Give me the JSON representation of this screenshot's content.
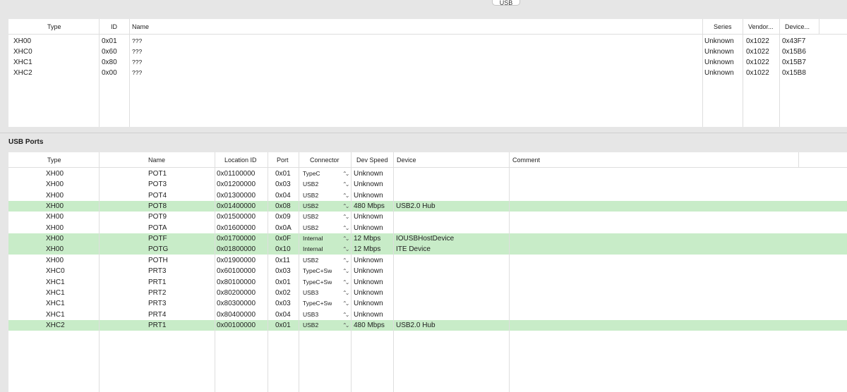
{
  "tab_label": "USB",
  "controllers": {
    "headers": {
      "type": "Type",
      "id": "ID",
      "name": "Name",
      "series": "Series",
      "vendor": "Vendor...",
      "device": "Device..."
    },
    "rows": [
      {
        "type": "XH00",
        "id": "0x01",
        "name": "???",
        "series": "Unknown",
        "vendor": "0x1022",
        "device": "0x43F7"
      },
      {
        "type": "XHC0",
        "id": "0x60",
        "name": "???",
        "series": "Unknown",
        "vendor": "0x1022",
        "device": "0x15B6"
      },
      {
        "type": "XHC1",
        "id": "0x80",
        "name": "???",
        "series": "Unknown",
        "vendor": "0x1022",
        "device": "0x15B7"
      },
      {
        "type": "XHC2",
        "id": "0x00",
        "name": "???",
        "series": "Unknown",
        "vendor": "0x1022",
        "device": "0x15B8"
      }
    ]
  },
  "ports_title": "USB Ports",
  "ports": {
    "headers": {
      "type": "Type",
      "name": "Name",
      "location": "Location ID",
      "port": "Port",
      "connector": "Connector",
      "speed": "Dev Speed",
      "device": "Device",
      "comment": "Comment"
    },
    "chevron": "⌃⌄",
    "rows": [
      {
        "type": "XH00",
        "name": "POT1",
        "location": "0x01100000",
        "port": "0x01",
        "connector": "TypeC",
        "speed": "Unknown",
        "device": "",
        "comment": "",
        "green": false
      },
      {
        "type": "XH00",
        "name": "POT3",
        "location": "0x01200000",
        "port": "0x03",
        "connector": "USB2",
        "speed": "Unknown",
        "device": "",
        "comment": "",
        "green": false
      },
      {
        "type": "XH00",
        "name": "POT4",
        "location": "0x01300000",
        "port": "0x04",
        "connector": "USB2",
        "speed": "Unknown",
        "device": "",
        "comment": "",
        "green": false
      },
      {
        "type": "XH00",
        "name": "POT8",
        "location": "0x01400000",
        "port": "0x08",
        "connector": "USB2",
        "speed": "480 Mbps",
        "device": "USB2.0 Hub",
        "comment": "",
        "green": true
      },
      {
        "type": "XH00",
        "name": "POT9",
        "location": "0x01500000",
        "port": "0x09",
        "connector": "USB2",
        "speed": "Unknown",
        "device": "",
        "comment": "",
        "green": false
      },
      {
        "type": "XH00",
        "name": "POTA",
        "location": "0x01600000",
        "port": "0x0A",
        "connector": "USB2",
        "speed": "Unknown",
        "device": "",
        "comment": "",
        "green": false
      },
      {
        "type": "XH00",
        "name": "POTF",
        "location": "0x01700000",
        "port": "0x0F",
        "connector": "Internal",
        "speed": "12 Mbps",
        "device": "IOUSBHostDevice",
        "comment": "",
        "green": true
      },
      {
        "type": "XH00",
        "name": "POTG",
        "location": "0x01800000",
        "port": "0x10",
        "connector": "Internal",
        "speed": "12 Mbps",
        "device": "ITE Device",
        "comment": "",
        "green": true
      },
      {
        "type": "XH00",
        "name": "POTH",
        "location": "0x01900000",
        "port": "0x11",
        "connector": "USB2",
        "speed": "Unknown",
        "device": "",
        "comment": "",
        "green": false
      },
      {
        "type": "XHC0",
        "name": "PRT3",
        "location": "0x60100000",
        "port": "0x03",
        "connector": "TypeC+Sw",
        "speed": "Unknown",
        "device": "",
        "comment": "",
        "green": false
      },
      {
        "type": "XHC1",
        "name": "PRT1",
        "location": "0x80100000",
        "port": "0x01",
        "connector": "TypeC+Sw",
        "speed": "Unknown",
        "device": "",
        "comment": "",
        "green": false
      },
      {
        "type": "XHC1",
        "name": "PRT2",
        "location": "0x80200000",
        "port": "0x02",
        "connector": "USB3",
        "speed": "Unknown",
        "device": "",
        "comment": "",
        "green": false
      },
      {
        "type": "XHC1",
        "name": "PRT3",
        "location": "0x80300000",
        "port": "0x03",
        "connector": "TypeC+Sw",
        "speed": "Unknown",
        "device": "",
        "comment": "",
        "green": false
      },
      {
        "type": "XHC1",
        "name": "PRT4",
        "location": "0x80400000",
        "port": "0x04",
        "connector": "USB3",
        "speed": "Unknown",
        "device": "",
        "comment": "",
        "green": false
      },
      {
        "type": "XHC2",
        "name": "PRT1",
        "location": "0x00100000",
        "port": "0x01",
        "connector": "USB2",
        "speed": "480 Mbps",
        "device": "USB2.0 Hub",
        "comment": "",
        "green": true
      }
    ]
  }
}
